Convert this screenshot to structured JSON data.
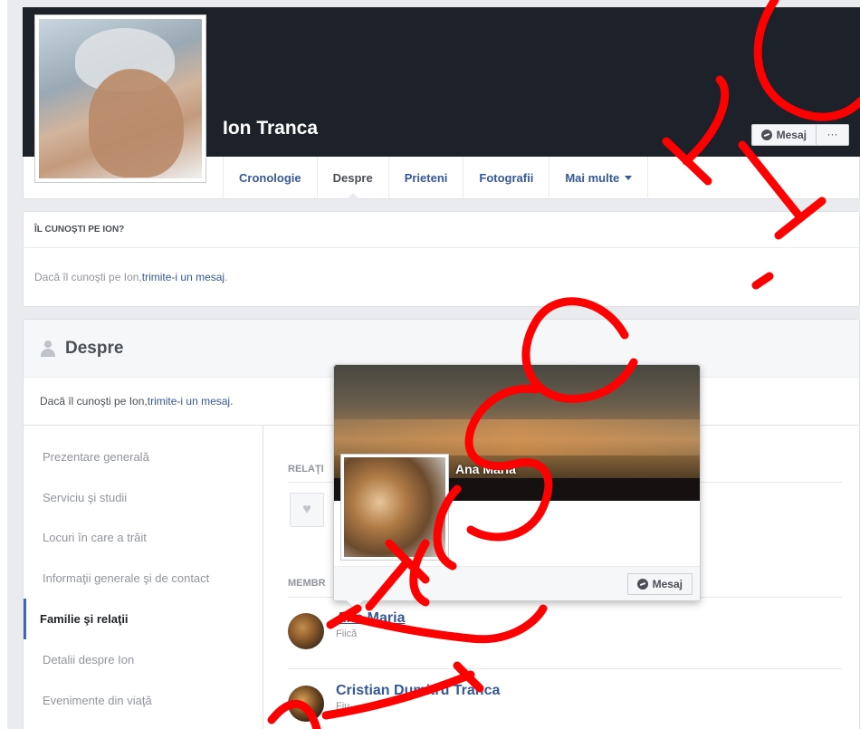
{
  "profile": {
    "name": "Ion Tranca",
    "message_label": "Mesaj",
    "more_label": "···"
  },
  "tabs": [
    {
      "label": "Cronologie"
    },
    {
      "label": "Despre"
    },
    {
      "label": "Prieteni"
    },
    {
      "label": "Fotografii"
    },
    {
      "label": "Mai multe"
    }
  ],
  "know_card": {
    "heading": "ÎL CUNOŞTI PE ION?",
    "text_before": "Dacă îl cunoşti pe Ion, ",
    "link": "trimite-i un mesaj",
    "text_after": "."
  },
  "about": {
    "title": "Despre",
    "know_before": "Dacă îl cunoşti pe Ion, ",
    "know_link": "trimite-i un mesaj",
    "know_after": ".",
    "nav": [
      {
        "label": "Prezentare generală"
      },
      {
        "label": "Serviciu şi studii"
      },
      {
        "label": "Locuri în care a trăit"
      },
      {
        "label": "Informaţii generale şi de contact"
      },
      {
        "label": "Familie şi relaţii"
      },
      {
        "label": "Detalii despre Ion"
      },
      {
        "label": "Evenimente din viaţă"
      }
    ],
    "relationship_heading": "RELAŢI",
    "members_heading": "MEMBR",
    "members": [
      {
        "name": "Ana Maria",
        "relation": "Fiică"
      },
      {
        "name": "Cristian Dumitru Tranca",
        "relation": "Fiu"
      }
    ]
  },
  "hovercard": {
    "name": "Ana Maria",
    "message_label": "Mesaj"
  }
}
